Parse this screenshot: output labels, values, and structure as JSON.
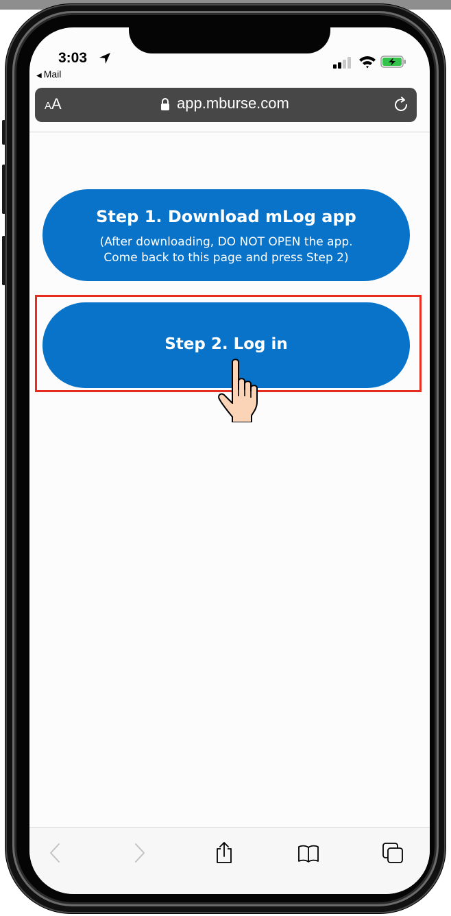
{
  "status_bar": {
    "time": "3:03",
    "back_to_app": "Mail"
  },
  "address_bar": {
    "text_size_button": "AA",
    "url": "app.mburse.com"
  },
  "main": {
    "step1": {
      "title": "Step 1. Download mLog app",
      "subtitle_line1": "(After downloading, DO NOT OPEN the app.",
      "subtitle_line2": "Come back to this page and press Step 2)"
    },
    "step2": {
      "title": "Step 2. Log in"
    }
  },
  "toolbar": {
    "items": [
      "back-icon",
      "forward-icon",
      "share-icon",
      "bookmarks-icon",
      "tabs-icon"
    ]
  },
  "colors": {
    "button_blue": "#0873c9",
    "highlight_red": "#e52d22",
    "address_bar_bg": "#474747"
  }
}
